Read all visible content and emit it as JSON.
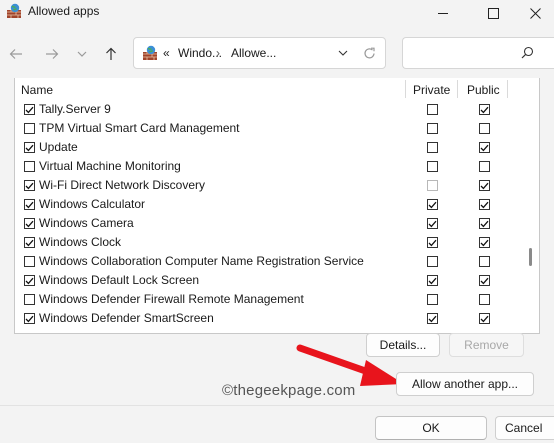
{
  "window": {
    "title": "Allowed apps"
  },
  "nav": {
    "breadcrumb_separator": "«",
    "path": [
      "Windo...",
      "Allowe..."
    ],
    "chevron": "›"
  },
  "list": {
    "headers": {
      "name": "Name",
      "private": "Private",
      "public": "Public"
    },
    "rows": [
      {
        "name": "Tally.Server 9",
        "enabled": true,
        "private": false,
        "public": true,
        "private_disabled": false
      },
      {
        "name": "TPM Virtual Smart Card Management",
        "enabled": false,
        "private": false,
        "public": false,
        "private_disabled": false
      },
      {
        "name": "Update",
        "enabled": true,
        "private": false,
        "public": true,
        "private_disabled": false
      },
      {
        "name": "Virtual Machine Monitoring",
        "enabled": false,
        "private": false,
        "public": false,
        "private_disabled": false
      },
      {
        "name": "Wi-Fi Direct Network Discovery",
        "enabled": true,
        "private": false,
        "public": true,
        "private_disabled": true
      },
      {
        "name": "Windows Calculator",
        "enabled": true,
        "private": true,
        "public": true,
        "private_disabled": false
      },
      {
        "name": "Windows Camera",
        "enabled": true,
        "private": true,
        "public": true,
        "private_disabled": false
      },
      {
        "name": "Windows Clock",
        "enabled": true,
        "private": true,
        "public": true,
        "private_disabled": false
      },
      {
        "name": "Windows Collaboration Computer Name Registration Service",
        "enabled": false,
        "private": false,
        "public": false,
        "private_disabled": false
      },
      {
        "name": "Windows Default Lock Screen",
        "enabled": true,
        "private": true,
        "public": true,
        "private_disabled": false
      },
      {
        "name": "Windows Defender Firewall Remote Management",
        "enabled": false,
        "private": false,
        "public": false,
        "private_disabled": false
      },
      {
        "name": "Windows Defender SmartScreen",
        "enabled": true,
        "private": true,
        "public": true,
        "private_disabled": false
      }
    ]
  },
  "buttons": {
    "details": "Details...",
    "remove": "Remove",
    "allow_another": "Allow another app...",
    "ok": "OK",
    "cancel": "Cancel"
  },
  "watermark": "©thegeekpage.com",
  "colors": {
    "arrow": "#e8141c",
    "accent": "#0067c0"
  }
}
